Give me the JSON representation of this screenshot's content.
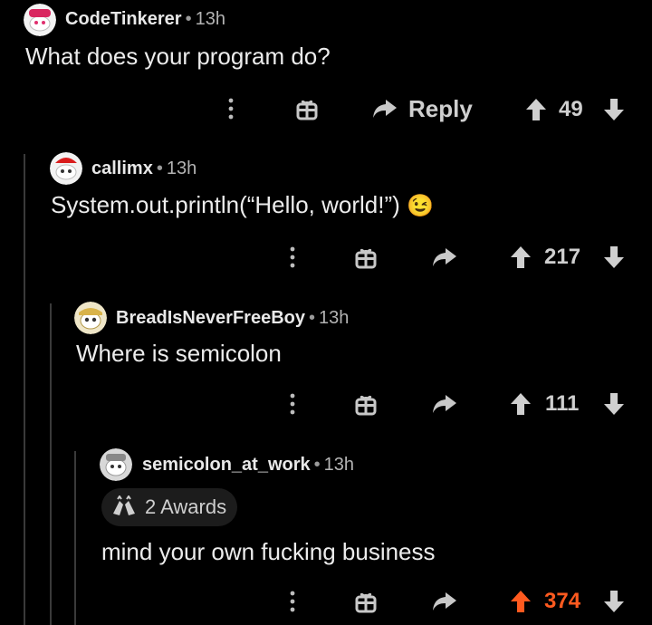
{
  "comments": [
    {
      "username": "CodeTinkerer",
      "time": "13h",
      "text": "What does your program do?",
      "reply_label": "Reply",
      "score": "49"
    },
    {
      "username": "callimx",
      "time": "13h",
      "text": "System.out.println(“Hello, world!”)",
      "emoji": "😉",
      "score": "217"
    },
    {
      "username": "BreadIsNeverFreeBoy",
      "time": "13h",
      "text": "Where is semicolon",
      "score": "111"
    },
    {
      "username": "semicolon_at_work",
      "time": "13h",
      "awards": "2 Awards",
      "text": "mind your own fucking business",
      "score": "374",
      "upvoted": true
    }
  ],
  "separator": "•",
  "colors": {
    "background": "#000000",
    "text": "#ececec",
    "muted": "#b3b3b3",
    "upvote_active": "#ff5a1f",
    "thread_line": "#3a3a3a"
  },
  "icons": [
    "more-options-icon",
    "gift-award-icon",
    "reply-arrow-icon",
    "upvote-arrow-icon",
    "downvote-arrow-icon",
    "emoji-wink-icon",
    "award-hands-icon"
  ]
}
